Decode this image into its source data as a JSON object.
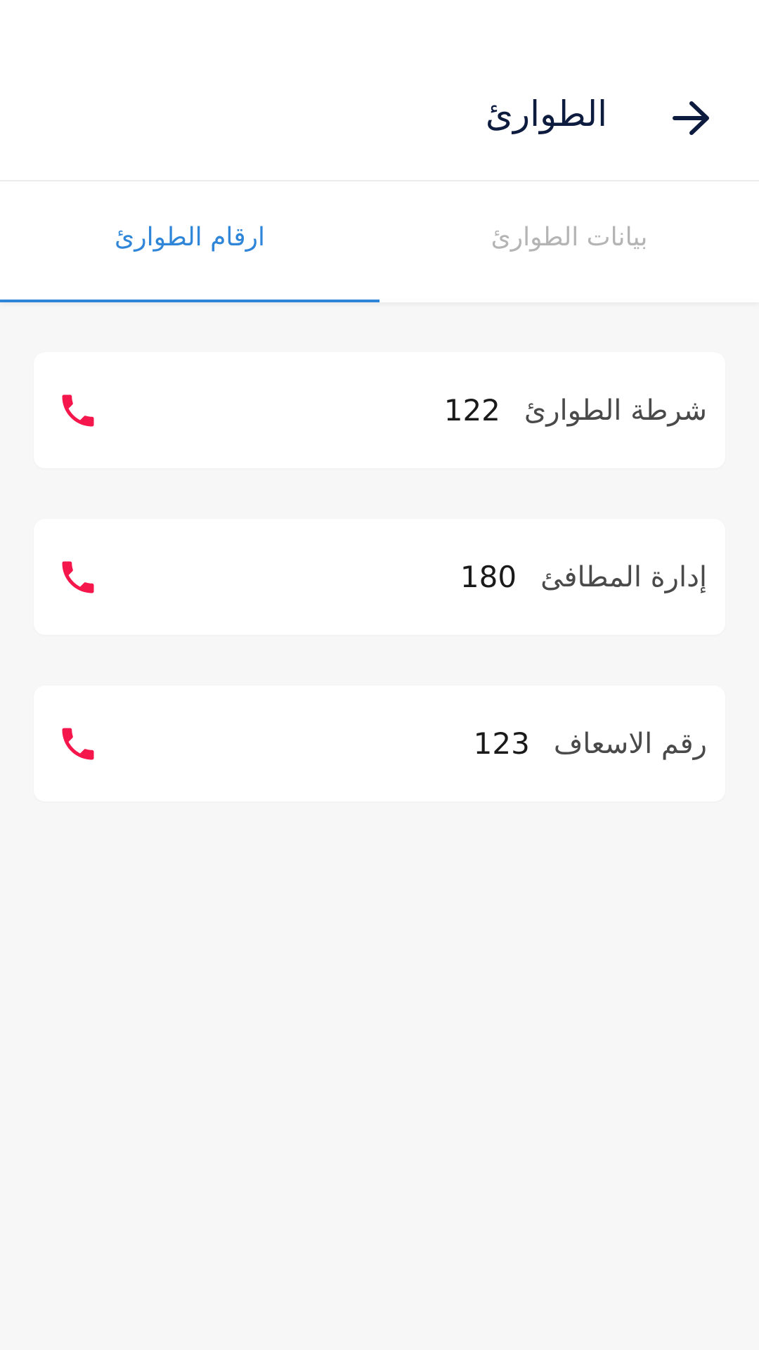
{
  "header": {
    "title": "الطوارئ",
    "back_icon": "arrow-right-icon"
  },
  "tabs": [
    {
      "label": "بيانات الطوارئ",
      "active": false
    },
    {
      "label": "ارقام الطوارئ",
      "active": true
    }
  ],
  "colors": {
    "accent": "#2f86d9",
    "call_icon": "#f5164b",
    "title": "#0d1b3e"
  },
  "emergency_numbers": [
    {
      "name": "شرطة الطوارئ",
      "number": "122",
      "icon": "phone-icon"
    },
    {
      "name": "إدارة المطافئ",
      "number": "180",
      "icon": "phone-icon"
    },
    {
      "name": "رقم الاسعاف",
      "number": "123",
      "icon": "phone-icon"
    }
  ]
}
